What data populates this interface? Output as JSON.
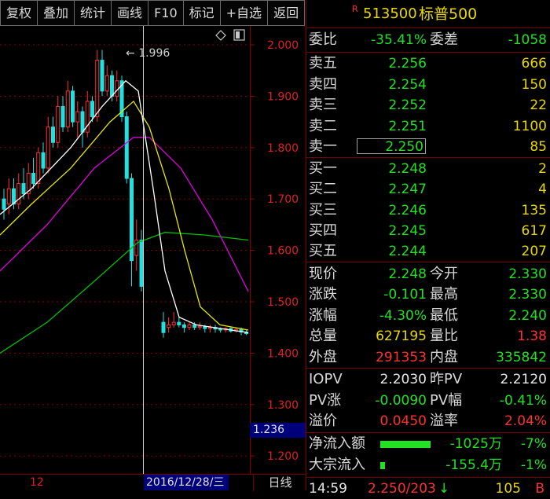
{
  "toolbar": [
    "复权",
    "叠加",
    "统计",
    "画线",
    "F10",
    "标记",
    "+自选",
    "返回"
  ],
  "chart": {
    "high_label": "1.996",
    "price_labels": [
      "2.000",
      "1.900",
      "1.800",
      "1.700",
      "1.600",
      "1.500",
      "1.400",
      "1.300",
      "1.200"
    ],
    "cursor_price": "1.236",
    "x_tick": "12",
    "cursor_date": "2016/12/28/三",
    "period": "日线",
    "icons": [
      "diamond-icon",
      "panel-toggle-icon"
    ]
  },
  "quote": {
    "badge": "R",
    "code": "513500",
    "name": "标普500",
    "webi_label": "委比",
    "webi_value": "-35.41%",
    "weicha_label": "委差",
    "weicha_value": "-1058",
    "sell": [
      {
        "label": "卖五",
        "price": "2.256",
        "vol": "666"
      },
      {
        "label": "卖四",
        "price": "2.254",
        "vol": "150"
      },
      {
        "label": "卖三",
        "price": "2.252",
        "vol": "22"
      },
      {
        "label": "卖二",
        "price": "2.251",
        "vol": "1100"
      },
      {
        "label": "卖一",
        "price": "2.250",
        "vol": "85"
      }
    ],
    "buy": [
      {
        "label": "买一",
        "price": "2.248",
        "vol": "2"
      },
      {
        "label": "买二",
        "price": "2.247",
        "vol": "4"
      },
      {
        "label": "买三",
        "price": "2.246",
        "vol": "135"
      },
      {
        "label": "买四",
        "price": "2.245",
        "vol": "617"
      },
      {
        "label": "买五",
        "price": "2.244",
        "vol": "207"
      }
    ],
    "stats": [
      {
        "l1": "现价",
        "v1": "2.248",
        "c1": "green",
        "l2": "今开",
        "v2": "2.330",
        "c2": "green"
      },
      {
        "l1": "涨跌",
        "v1": "-0.101",
        "c1": "green",
        "l2": "最高",
        "v2": "2.330",
        "c2": "green"
      },
      {
        "l1": "涨幅",
        "v1": "-4.30%",
        "c1": "green",
        "l2": "最低",
        "v2": "2.240",
        "c2": "green"
      },
      {
        "l1": "总量",
        "v1": "627195",
        "c1": "yellow",
        "l2": "量比",
        "v2": "1.38",
        "c2": "red"
      },
      {
        "l1": "外盘",
        "v1": "291353",
        "c1": "red",
        "l2": "内盘",
        "v2": "335842",
        "c2": "green"
      }
    ],
    "iopv": [
      {
        "l1": "IOPV",
        "v1": "2.2030",
        "c1": "white",
        "l2": "昨PV",
        "v2": "2.2120",
        "c2": "white"
      },
      {
        "l1": "PV涨",
        "v1": "-0.0090",
        "c1": "green",
        "l2": "PV幅",
        "v2": "-0.41%",
        "c2": "green"
      },
      {
        "l1": "溢价",
        "v1": "0.0450",
        "c1": "red",
        "l2": "溢率",
        "v2": "2.04%",
        "c2": "red"
      }
    ],
    "flows": [
      {
        "label": "净流入额",
        "value": "-1025万",
        "pct": "-7%"
      },
      {
        "label": "大宗流入",
        "value": "-155.4万",
        "pct": "-1%"
      }
    ],
    "last_tick": {
      "time": "14:59",
      "price": "2.250/203",
      "dir": "↓",
      "vol": "105",
      "flag": "B"
    }
  },
  "colors": {
    "up": "#ff3030",
    "down": "#22e0e0",
    "ma5": "#ffffff",
    "ma10": "#e8e800",
    "ma20": "#e000e0",
    "ma60": "#00c000",
    "grid": "#8a0000"
  }
}
